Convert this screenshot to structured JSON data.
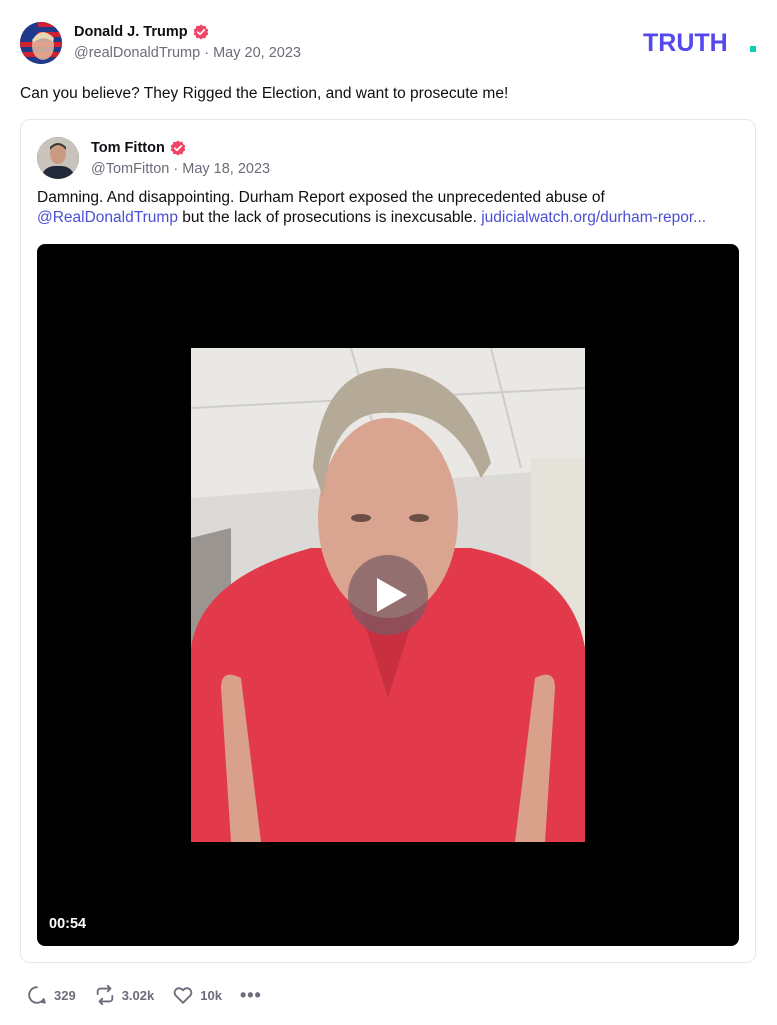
{
  "post": {
    "author_name": "Donald J. Trump",
    "handle_date": "@realDonaldTrump · May 20, 2023",
    "text": "Can you believe? They Rigged the Election, and want to prosecute me!"
  },
  "brand": {
    "logo_text": "TRUTH",
    "logo_color": "#5448ee",
    "accent_dot": "#0ccfb4"
  },
  "quote": {
    "author_name": "Tom Fitton",
    "handle_date": "@TomFitton · May 18, 2023",
    "text_start": "Damning. And disappointing. Durham Report exposed the unprecedented abuse of",
    "mention": "@RealDonaldTrump",
    "text_mid": " but the lack of prosecutions is inexcusable. ",
    "link": "judicialwatch.org/durham-repor..."
  },
  "video": {
    "duration": "00:54"
  },
  "actions": {
    "replies": "329",
    "retruths": "3.02k",
    "likes": "10k",
    "more_icon": "more-icon"
  },
  "colors": {
    "verified": "#f0466a",
    "link": "#4b4ed4",
    "muted": "#6c6c7a"
  }
}
